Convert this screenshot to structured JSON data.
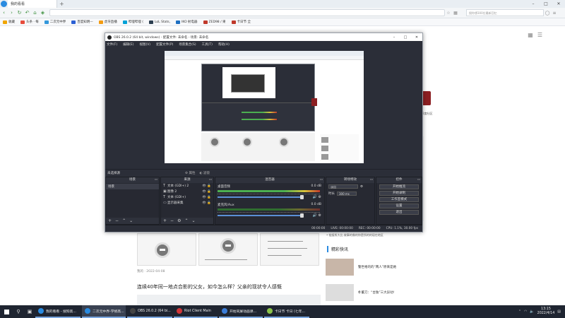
{
  "browser": {
    "tab_title": "我的看看",
    "search_placeholder": "搜你想300位最新回忆",
    "bookmarks": [
      {
        "label": "收藏",
        "color": "#f0a500"
      },
      {
        "label": "头条 · 每",
        "color": "#e74c3c"
      },
      {
        "label": "二次元中界",
        "color": "#3498db"
      },
      {
        "label": "百度知明—",
        "color": "#2c60d4"
      },
      {
        "label": "虎牙直播",
        "color": "#f39c12"
      },
      {
        "label": "哔哩哔哩 (",
        "color": "#00a1d6"
      },
      {
        "label": "LoL Stats,",
        "color": "#2c3e50"
      },
      {
        "label": "IKO 射电器",
        "color": "#1e6fc1"
      },
      {
        "label": "ZED98 / 果",
        "color": "#c0392b"
      },
      {
        "label": "卡日节 全",
        "color": "#c0392b"
      }
    ]
  },
  "page": {
    "sidebar_badge_label": "2度社区",
    "article_meta": "我的 · 2022-04-08",
    "article_title": "连续40年同一地点合影的父女，如今怎么样？父亲的现状令人感慨",
    "right_list_top": "• 链接所大比 故事的像的你是所的的现在地区",
    "wonderful_title": "精彩快讯",
    "news": [
      {
        "title": "警世格的的“两人”原来是她"
      },
      {
        "title": "朴董刀：“台独”三大异动!"
      }
    ]
  },
  "obs": {
    "title": "OBS 26.0.2 (64 bit, windows) - 配置文件: 未命名 - 场景: 未命名",
    "menu": [
      "文件(F)",
      "编辑(E)",
      "视图(V)",
      "配置文件(P)",
      "场景集合(S)",
      "工具(T)",
      "帮助(H)"
    ],
    "scene_bar_label": "未选择源",
    "scene_bar_btn_props": "属性",
    "scene_bar_btn_filters": "滤镜",
    "docks": {
      "scenes": "场景",
      "sources": "来源",
      "mixer": "混音器",
      "transitions": "转场特效",
      "controls": "控件"
    },
    "scene_items": [
      "场景"
    ],
    "sources": [
      {
        "icon": "T",
        "label": "文本 (GDI+) 2"
      },
      {
        "icon": "▣",
        "label": "图像 2"
      },
      {
        "icon": "T",
        "label": "文本 (GDI+)"
      },
      {
        "icon": "▭",
        "label": "显示器采集"
      }
    ],
    "mixer": [
      {
        "name": "桌面音频",
        "db": "0.0 dB"
      },
      {
        "name": "麦克风/Aux",
        "db": "0.0 dB"
      }
    ],
    "transition_select": "淡出",
    "transition_duration_label": "时长",
    "transition_duration_value": "300 ms",
    "controls": [
      "开始推流",
      "开始录制",
      "工作室模式",
      "设置",
      "退出"
    ],
    "status": {
      "live": "LIVE: 00:00:00",
      "rec": "REC: 00:00:00",
      "cpu": "CPU: 1.1%, 30.00 fps",
      "dropped": "00:00:00"
    }
  },
  "taskbar": {
    "tasks": [
      {
        "label": "我的看看 - 搜狗高...",
        "color": "#2a8be0",
        "active": false
      },
      {
        "label": "二次元中界-学修高...",
        "color": "#2a8be0",
        "active": true
      },
      {
        "label": "OBS 26.0.2 (64 bi...",
        "color": "#444",
        "active": false
      },
      {
        "label": "Riot Client Main",
        "color": "#d13639",
        "active": false
      },
      {
        "label": "开始同屏动画课...",
        "color": "#3b7dd8",
        "active": false
      },
      {
        "label": "卡日节 卡日 (七年...",
        "color": "#8bc34a",
        "active": false
      }
    ],
    "time": "13:15",
    "date": "2022/4/14"
  },
  "colors": {
    "obs_bg": "#2b2e38",
    "browser_accent": "#2a8be0",
    "taskbar_bg": "#1f2531"
  }
}
